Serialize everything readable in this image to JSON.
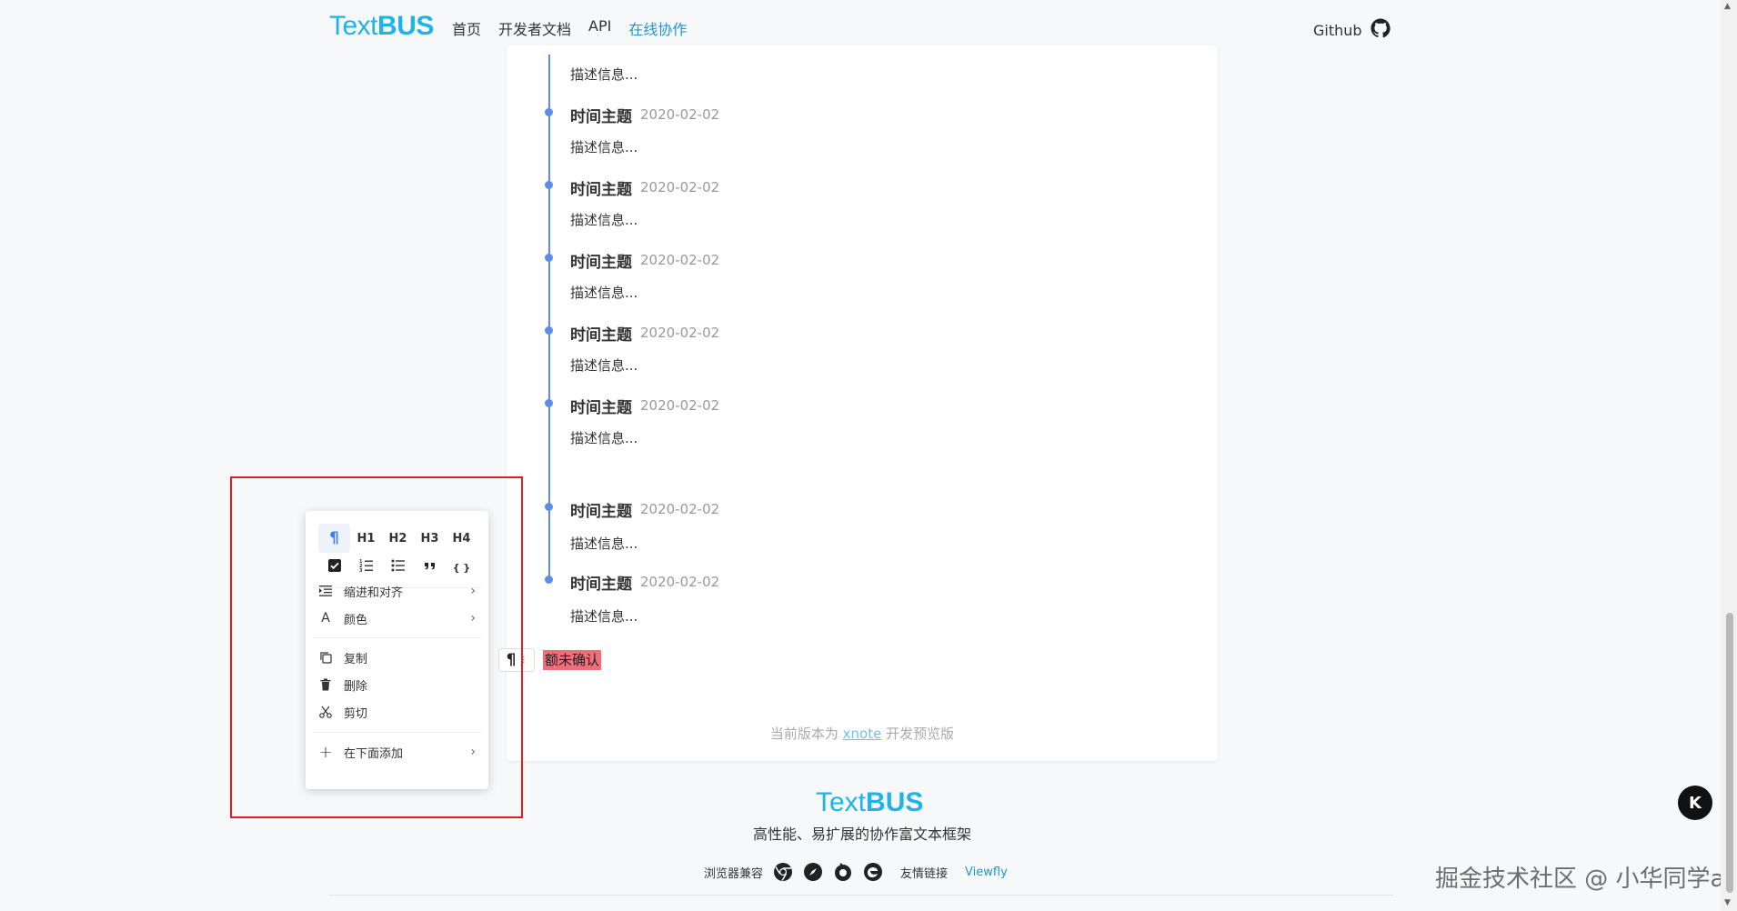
{
  "header": {
    "logo_light": "Text",
    "logo_bold": "BUS",
    "nav": [
      {
        "label": "首页"
      },
      {
        "label": "开发者文档"
      },
      {
        "label": "API"
      },
      {
        "label": "在线协作"
      }
    ],
    "github_label": "Github"
  },
  "timeline": {
    "items": [
      {
        "title": "时间主题",
        "date": "2020-02-02",
        "desc": "描述信息..."
      },
      {
        "title": "时间主题",
        "date": "2020-02-02",
        "desc": "描述信息..."
      },
      {
        "title": "时间主题",
        "date": "2020-02-02",
        "desc": "描述信息..."
      },
      {
        "title": "时间主题",
        "date": "2020-02-02",
        "desc": "描述信息..."
      },
      {
        "title": "时间主题",
        "date": "2020-02-02",
        "desc": "描述信息..."
      },
      {
        "title": "时间主题",
        "date": "2020-02-02",
        "desc": "描述信息..."
      },
      {
        "title": "时间主题",
        "date": "2020-02-02",
        "desc": "描述信息..."
      }
    ],
    "top_desc": "描述信息..."
  },
  "editor": {
    "paragraph_handle": "¶",
    "highlight_text": "额未确认",
    "version_prefix": "当前版本为",
    "version_link": "xnote",
    "version_suffix": "开发预览版"
  },
  "menu": {
    "tools": [
      {
        "label": "¶",
        "icon": "paragraph-icon"
      },
      {
        "label": "H1",
        "icon": "h1-icon"
      },
      {
        "label": "H2",
        "icon": "h2-icon"
      },
      {
        "label": "H3",
        "icon": "h3-icon"
      },
      {
        "label": "H4",
        "icon": "h4-icon"
      },
      {
        "label": "",
        "icon": "checkbox-icon"
      },
      {
        "label": "",
        "icon": "ordered-list-icon"
      },
      {
        "label": "",
        "icon": "unordered-list-icon"
      },
      {
        "label": "",
        "icon": "quote-icon"
      },
      {
        "label": "{ }",
        "icon": "code-icon"
      }
    ],
    "indent_align": "缩进和对齐",
    "color": "颜色",
    "copy": "复制",
    "delete": "删除",
    "cut": "剪切",
    "add_below": "在下面添加"
  },
  "footer": {
    "logo_light": "Text",
    "logo_bold": "BUS",
    "tagline": "高性能、易扩展的协作富文本框架",
    "browser_compat": "浏览器兼容",
    "friend_links": "友情链接",
    "viewfly": "Viewfly"
  },
  "float_button": "K",
  "watermark": "掘金技术社区 @ 小华同学ai",
  "colors": {
    "brand": "#1fb3e6",
    "timeline": "#5a8ee8",
    "highlight": "#f06e7a",
    "annotation_box": "#e02020"
  }
}
